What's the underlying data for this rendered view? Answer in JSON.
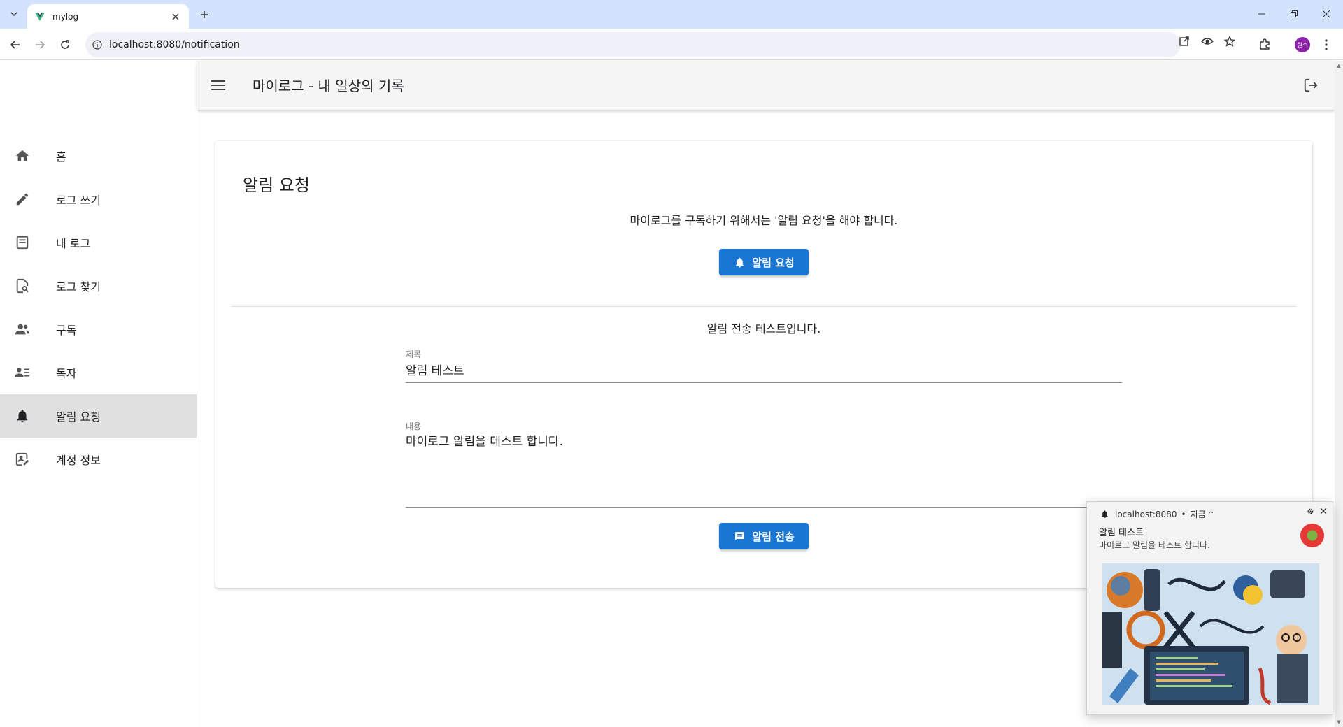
{
  "browser": {
    "tab_title": "mylog",
    "url": "localhost:8080/notification",
    "profile_initials": "원수"
  },
  "app": {
    "title": "마이로그 - 내 일상의 기록",
    "nav": [
      {
        "label": "홈",
        "icon": "home-icon"
      },
      {
        "label": "로그 쓰기",
        "icon": "pencil-icon"
      },
      {
        "label": "내 로그",
        "icon": "article-icon"
      },
      {
        "label": "로그 찾기",
        "icon": "find-doc-icon"
      },
      {
        "label": "구독",
        "icon": "people-icon"
      },
      {
        "label": "독자",
        "icon": "people-list-icon"
      },
      {
        "label": "알림 요청",
        "icon": "bell-icon"
      },
      {
        "label": "계정 정보",
        "icon": "account-edit-icon"
      }
    ],
    "active_nav_index": 6
  },
  "card": {
    "title": "알림 요청",
    "subscribe_message": "마이로그를 구독하기 위해서는 '알림 요청'을 해야 합니다.",
    "request_button": "알림 요청",
    "test_message": "알림 전송 테스트입니다.",
    "title_field": {
      "label": "제목",
      "value": "알림 테스트"
    },
    "content_field": {
      "label": "내용",
      "value": "마이로그 알림을 테스트 합니다."
    },
    "send_button": "알림 전송"
  },
  "notification": {
    "origin": "localhost:8080",
    "time": "지금",
    "title": "알림 테스트",
    "body": "마이로그 알림을 테스트 합니다."
  },
  "colors": {
    "primary": "#1976d2",
    "tabstrip": "#d3e3fd",
    "appbar": "#f5f5f5",
    "active_nav": "#e0e0e0"
  }
}
